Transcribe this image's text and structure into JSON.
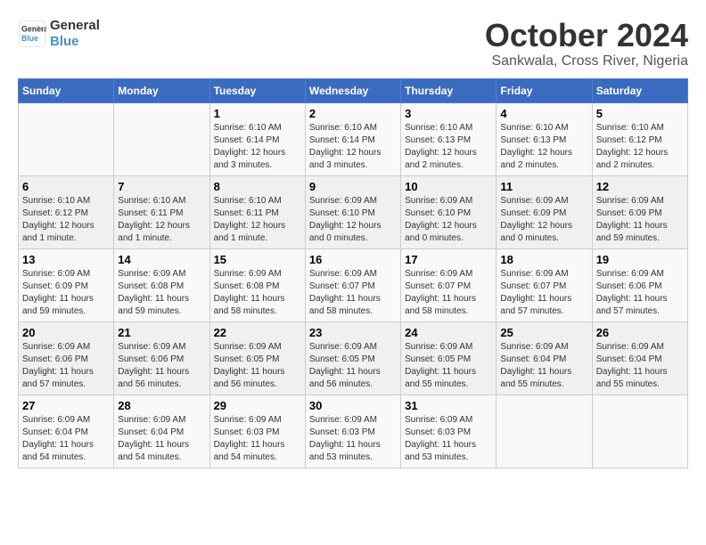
{
  "logo": {
    "line1": "General",
    "line2": "Blue"
  },
  "title": "October 2024",
  "subtitle": "Sankwala, Cross River, Nigeria",
  "weekdays": [
    "Sunday",
    "Monday",
    "Tuesday",
    "Wednesday",
    "Thursday",
    "Friday",
    "Saturday"
  ],
  "weeks": [
    [
      {
        "day": "",
        "info": ""
      },
      {
        "day": "",
        "info": ""
      },
      {
        "day": "1",
        "info": "Sunrise: 6:10 AM\nSunset: 6:14 PM\nDaylight: 12 hours\nand 3 minutes."
      },
      {
        "day": "2",
        "info": "Sunrise: 6:10 AM\nSunset: 6:14 PM\nDaylight: 12 hours\nand 3 minutes."
      },
      {
        "day": "3",
        "info": "Sunrise: 6:10 AM\nSunset: 6:13 PM\nDaylight: 12 hours\nand 2 minutes."
      },
      {
        "day": "4",
        "info": "Sunrise: 6:10 AM\nSunset: 6:13 PM\nDaylight: 12 hours\nand 2 minutes."
      },
      {
        "day": "5",
        "info": "Sunrise: 6:10 AM\nSunset: 6:12 PM\nDaylight: 12 hours\nand 2 minutes."
      }
    ],
    [
      {
        "day": "6",
        "info": "Sunrise: 6:10 AM\nSunset: 6:12 PM\nDaylight: 12 hours\nand 1 minute."
      },
      {
        "day": "7",
        "info": "Sunrise: 6:10 AM\nSunset: 6:11 PM\nDaylight: 12 hours\nand 1 minute."
      },
      {
        "day": "8",
        "info": "Sunrise: 6:10 AM\nSunset: 6:11 PM\nDaylight: 12 hours\nand 1 minute."
      },
      {
        "day": "9",
        "info": "Sunrise: 6:09 AM\nSunset: 6:10 PM\nDaylight: 12 hours\nand 0 minutes."
      },
      {
        "day": "10",
        "info": "Sunrise: 6:09 AM\nSunset: 6:10 PM\nDaylight: 12 hours\nand 0 minutes."
      },
      {
        "day": "11",
        "info": "Sunrise: 6:09 AM\nSunset: 6:09 PM\nDaylight: 12 hours\nand 0 minutes."
      },
      {
        "day": "12",
        "info": "Sunrise: 6:09 AM\nSunset: 6:09 PM\nDaylight: 11 hours\nand 59 minutes."
      }
    ],
    [
      {
        "day": "13",
        "info": "Sunrise: 6:09 AM\nSunset: 6:09 PM\nDaylight: 11 hours\nand 59 minutes."
      },
      {
        "day": "14",
        "info": "Sunrise: 6:09 AM\nSunset: 6:08 PM\nDaylight: 11 hours\nand 59 minutes."
      },
      {
        "day": "15",
        "info": "Sunrise: 6:09 AM\nSunset: 6:08 PM\nDaylight: 11 hours\nand 58 minutes."
      },
      {
        "day": "16",
        "info": "Sunrise: 6:09 AM\nSunset: 6:07 PM\nDaylight: 11 hours\nand 58 minutes."
      },
      {
        "day": "17",
        "info": "Sunrise: 6:09 AM\nSunset: 6:07 PM\nDaylight: 11 hours\nand 58 minutes."
      },
      {
        "day": "18",
        "info": "Sunrise: 6:09 AM\nSunset: 6:07 PM\nDaylight: 11 hours\nand 57 minutes."
      },
      {
        "day": "19",
        "info": "Sunrise: 6:09 AM\nSunset: 6:06 PM\nDaylight: 11 hours\nand 57 minutes."
      }
    ],
    [
      {
        "day": "20",
        "info": "Sunrise: 6:09 AM\nSunset: 6:06 PM\nDaylight: 11 hours\nand 57 minutes."
      },
      {
        "day": "21",
        "info": "Sunrise: 6:09 AM\nSunset: 6:06 PM\nDaylight: 11 hours\nand 56 minutes."
      },
      {
        "day": "22",
        "info": "Sunrise: 6:09 AM\nSunset: 6:05 PM\nDaylight: 11 hours\nand 56 minutes."
      },
      {
        "day": "23",
        "info": "Sunrise: 6:09 AM\nSunset: 6:05 PM\nDaylight: 11 hours\nand 56 minutes."
      },
      {
        "day": "24",
        "info": "Sunrise: 6:09 AM\nSunset: 6:05 PM\nDaylight: 11 hours\nand 55 minutes."
      },
      {
        "day": "25",
        "info": "Sunrise: 6:09 AM\nSunset: 6:04 PM\nDaylight: 11 hours\nand 55 minutes."
      },
      {
        "day": "26",
        "info": "Sunrise: 6:09 AM\nSunset: 6:04 PM\nDaylight: 11 hours\nand 55 minutes."
      }
    ],
    [
      {
        "day": "27",
        "info": "Sunrise: 6:09 AM\nSunset: 6:04 PM\nDaylight: 11 hours\nand 54 minutes."
      },
      {
        "day": "28",
        "info": "Sunrise: 6:09 AM\nSunset: 6:04 PM\nDaylight: 11 hours\nand 54 minutes."
      },
      {
        "day": "29",
        "info": "Sunrise: 6:09 AM\nSunset: 6:03 PM\nDaylight: 11 hours\nand 54 minutes."
      },
      {
        "day": "30",
        "info": "Sunrise: 6:09 AM\nSunset: 6:03 PM\nDaylight: 11 hours\nand 53 minutes."
      },
      {
        "day": "31",
        "info": "Sunrise: 6:09 AM\nSunset: 6:03 PM\nDaylight: 11 hours\nand 53 minutes."
      },
      {
        "day": "",
        "info": ""
      },
      {
        "day": "",
        "info": ""
      }
    ]
  ]
}
